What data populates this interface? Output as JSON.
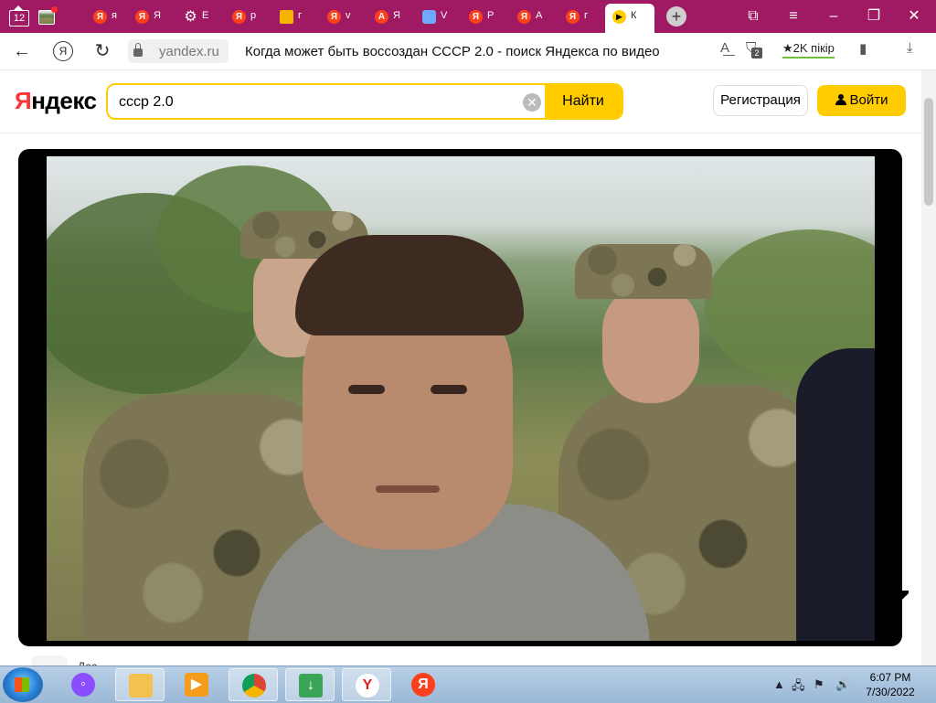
{
  "window": {
    "tab_count": "12",
    "tabs": [
      {
        "icon": "yandex-icon",
        "label": "я"
      },
      {
        "icon": "yandex-icon",
        "label": "Я"
      },
      {
        "icon": "gear-icon",
        "label": "E"
      },
      {
        "icon": "yandex-icon",
        "label": "р"
      },
      {
        "icon": "image-icon",
        "label": "г"
      },
      {
        "icon": "yandex-icon",
        "label": "v"
      },
      {
        "icon": "translate-icon",
        "label": "Я"
      },
      {
        "icon": "window-icon",
        "label": "V"
      },
      {
        "icon": "yandex-icon",
        "label": "Р"
      },
      {
        "icon": "yandex-icon",
        "label": "А"
      },
      {
        "icon": "yandex-icon",
        "label": "г"
      },
      {
        "icon": "video-icon",
        "label": "К"
      }
    ],
    "accent_color": "#a01a63"
  },
  "addressbar": {
    "domain": "yandex.ru",
    "page_title": "Когда может быть воссоздан СССР 2.0 - поиск Яндекса по видео",
    "bookmarks_badge": "2",
    "pikir_label": "★2K пікір"
  },
  "yandex": {
    "logo": "Яндекс",
    "search_value": "сссp 2.0",
    "find_label": "Найти",
    "register_label": "Регистрация",
    "login_label": "Войти",
    "brand_yellow": "#ffcc00"
  },
  "content": {
    "peek_text": "Доо"
  },
  "taskbar": {
    "time": "6:07 PM",
    "date": "7/30/2022"
  }
}
